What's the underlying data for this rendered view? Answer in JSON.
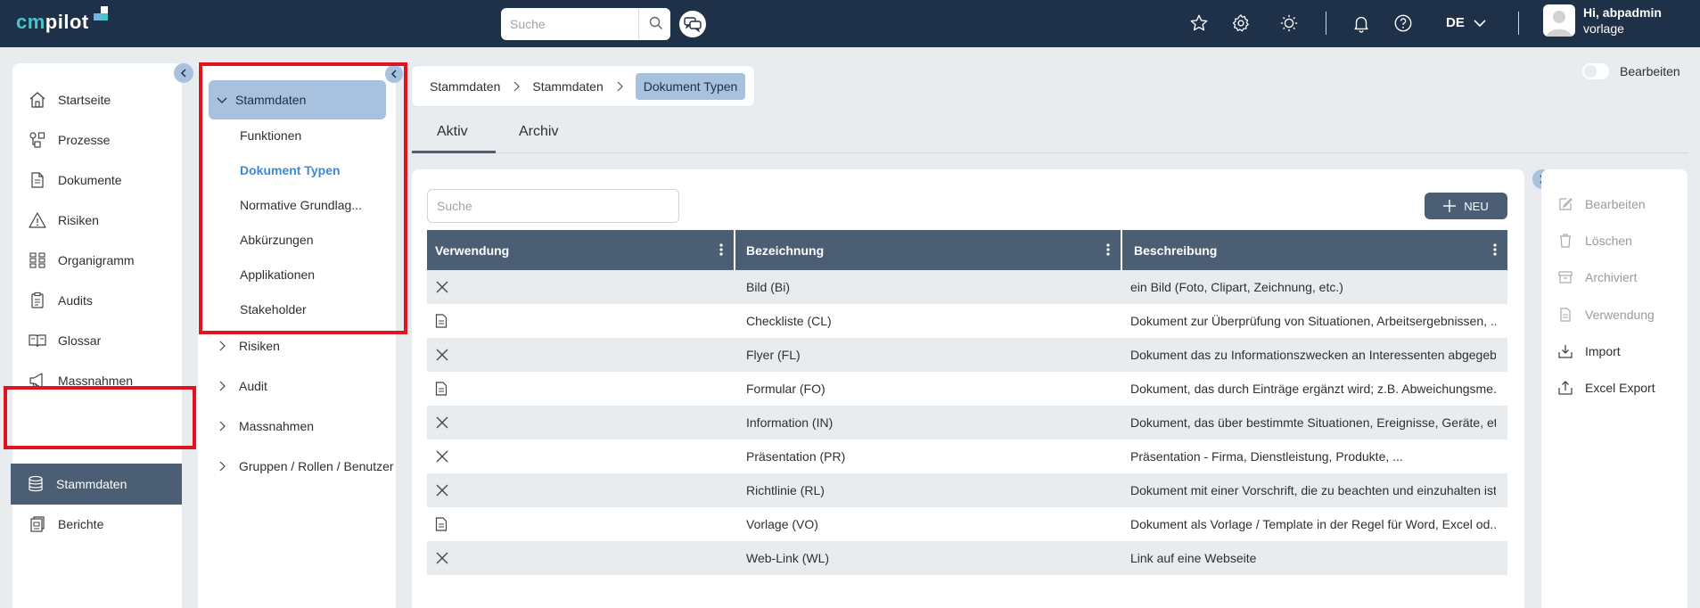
{
  "header": {
    "logo_cm": "cm",
    "logo_rest": "pilot",
    "search_placeholder": "Suche",
    "language": "DE",
    "user_greeting": "Hi, abpadmin",
    "user_org": "vorlage",
    "icons": [
      "star-icon",
      "gear-icon",
      "sun-icon",
      "bell-icon",
      "help-icon",
      "chat-icon"
    ]
  },
  "sidebar": {
    "items": [
      {
        "label": "Startseite",
        "icon": "home-icon"
      },
      {
        "label": "Prozesse",
        "icon": "process-icon"
      },
      {
        "label": "Dokumente",
        "icon": "document-icon"
      },
      {
        "label": "Risiken",
        "icon": "warning-icon"
      },
      {
        "label": "Organigramm",
        "icon": "org-chart-icon"
      },
      {
        "label": "Audits",
        "icon": "clipboard-icon"
      },
      {
        "label": "Glossar",
        "icon": "book-icon"
      },
      {
        "label": "Massnahmen",
        "icon": "megaphone-icon"
      },
      {
        "label": "Stammdaten",
        "icon": "database-icon"
      },
      {
        "label": "Berichte",
        "icon": "report-icon"
      }
    ]
  },
  "subnav": {
    "head": "Stammdaten",
    "items": [
      "Funktionen",
      "Dokument Typen",
      "Normative Grundlag...",
      "Abkürzungen",
      "Applikationen",
      "Stakeholder"
    ],
    "groups": [
      "Risiken",
      "Audit",
      "Massnahmen",
      "Gruppen / Rollen / Benutzer"
    ]
  },
  "breadcrumb": [
    "Stammdaten",
    "Stammdaten",
    "Dokument Typen"
  ],
  "edit_toggle_label": "Bearbeiten",
  "tabs": [
    "Aktiv",
    "Archiv"
  ],
  "main": {
    "search_placeholder": "Suche",
    "new_button": "NEU",
    "columns": [
      "Verwendung",
      "Bezeichnung",
      "Beschreibung"
    ],
    "rows": [
      {
        "icon": "x-icon",
        "name": "Bild (Bi)",
        "desc": "ein Bild (Foto, Clipart, Zeichnung, etc.)"
      },
      {
        "icon": "document-icon",
        "name": "Checkliste (CL)",
        "desc": "Dokument zur Überprüfung von Situationen, Arbeitsergebnissen, ..."
      },
      {
        "icon": "x-icon",
        "name": "Flyer (FL)",
        "desc": "Dokument das zu Informationszwecken an Interessenten abgegeb..."
      },
      {
        "icon": "document-icon",
        "name": "Formular (FO)",
        "desc": "Dokument, das durch Einträge ergänzt wird; z.B. Abweichungsme..."
      },
      {
        "icon": "x-icon",
        "name": "Information (IN)",
        "desc": "Dokument, das über bestimmte Situationen, Ereignisse, Geräte, et..."
      },
      {
        "icon": "x-icon",
        "name": "Präsentation (PR)",
        "desc": "Präsentation - Firma, Dienstleistung, Produkte, ..."
      },
      {
        "icon": "x-icon",
        "name": "Richtlinie (RL)",
        "desc": "Dokument mit einer Vorschrift, die zu beachten und einzuhalten ist"
      },
      {
        "icon": "document-icon",
        "name": "Vorlage (VO)",
        "desc": "Dokument als Vorlage / Template in der Regel für Word, Excel od..."
      },
      {
        "icon": "x-icon",
        "name": "Web-Link (WL)",
        "desc": "Link auf eine Webseite"
      }
    ]
  },
  "actions": [
    {
      "label": "Bearbeiten",
      "enabled": false,
      "icon": "edit-icon"
    },
    {
      "label": "Löschen",
      "enabled": false,
      "icon": "trash-icon"
    },
    {
      "label": "Archiviert",
      "enabled": false,
      "icon": "archive-icon"
    },
    {
      "label": "Verwendung",
      "enabled": false,
      "icon": "document-icon"
    },
    {
      "label": "Import",
      "enabled": true,
      "icon": "import-icon"
    },
    {
      "label": "Excel Export",
      "enabled": true,
      "icon": "export-icon"
    }
  ],
  "colors": {
    "topbar": "#1f3049",
    "accent": "#4b5e74",
    "highlight": "#a7c1de",
    "link_active": "#3b8ad6",
    "annotation_red": "#e0141e"
  }
}
